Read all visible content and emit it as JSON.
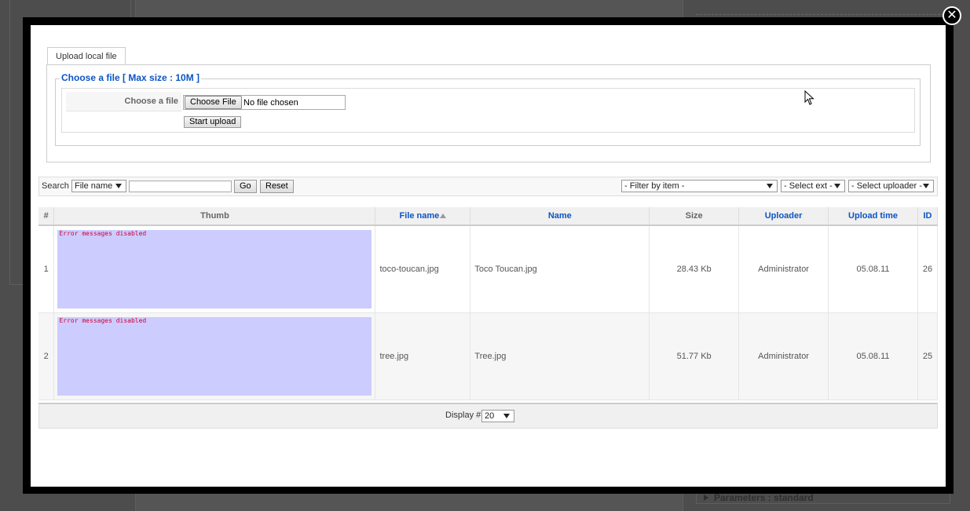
{
  "background": {
    "params_label": "Parameters : standard"
  },
  "modal": {
    "close_glyph": "✕"
  },
  "upload": {
    "tab_label": "Upload local file",
    "legend": "Choose a file [ Max size : 10M ]",
    "field_label": "Choose a file",
    "choose_button": "Choose File",
    "file_status": "No file chosen",
    "start_button": "Start upload"
  },
  "search": {
    "label": "Search",
    "field_select": "File name",
    "query": "",
    "go_button": "Go",
    "reset_button": "Reset",
    "filter_item": "- Filter by item -",
    "filter_ext": "- Select ext -",
    "filter_uploader": "- Select uploader -"
  },
  "table": {
    "headers": {
      "num": "#",
      "thumb": "Thumb",
      "file_name": "File name",
      "name": "Name",
      "size": "Size",
      "uploader": "Uploader",
      "upload_time": "Upload time",
      "id": "ID"
    },
    "rows": [
      {
        "num": "1",
        "thumb_error": "Error messages disabled",
        "file_name": "toco-toucan.jpg",
        "name": "Toco Toucan.jpg",
        "size": "28.43 Kb",
        "uploader": "Administrator",
        "upload_time": "05.08.11",
        "id": "26"
      },
      {
        "num": "2",
        "thumb_error": "Error messages disabled",
        "file_name": "tree.jpg",
        "name": "Tree.jpg",
        "size": "51.77 Kb",
        "uploader": "Administrator",
        "upload_time": "05.08.11",
        "id": "25"
      }
    ]
  },
  "footer": {
    "display_label": "Display #",
    "display_value": "20"
  }
}
